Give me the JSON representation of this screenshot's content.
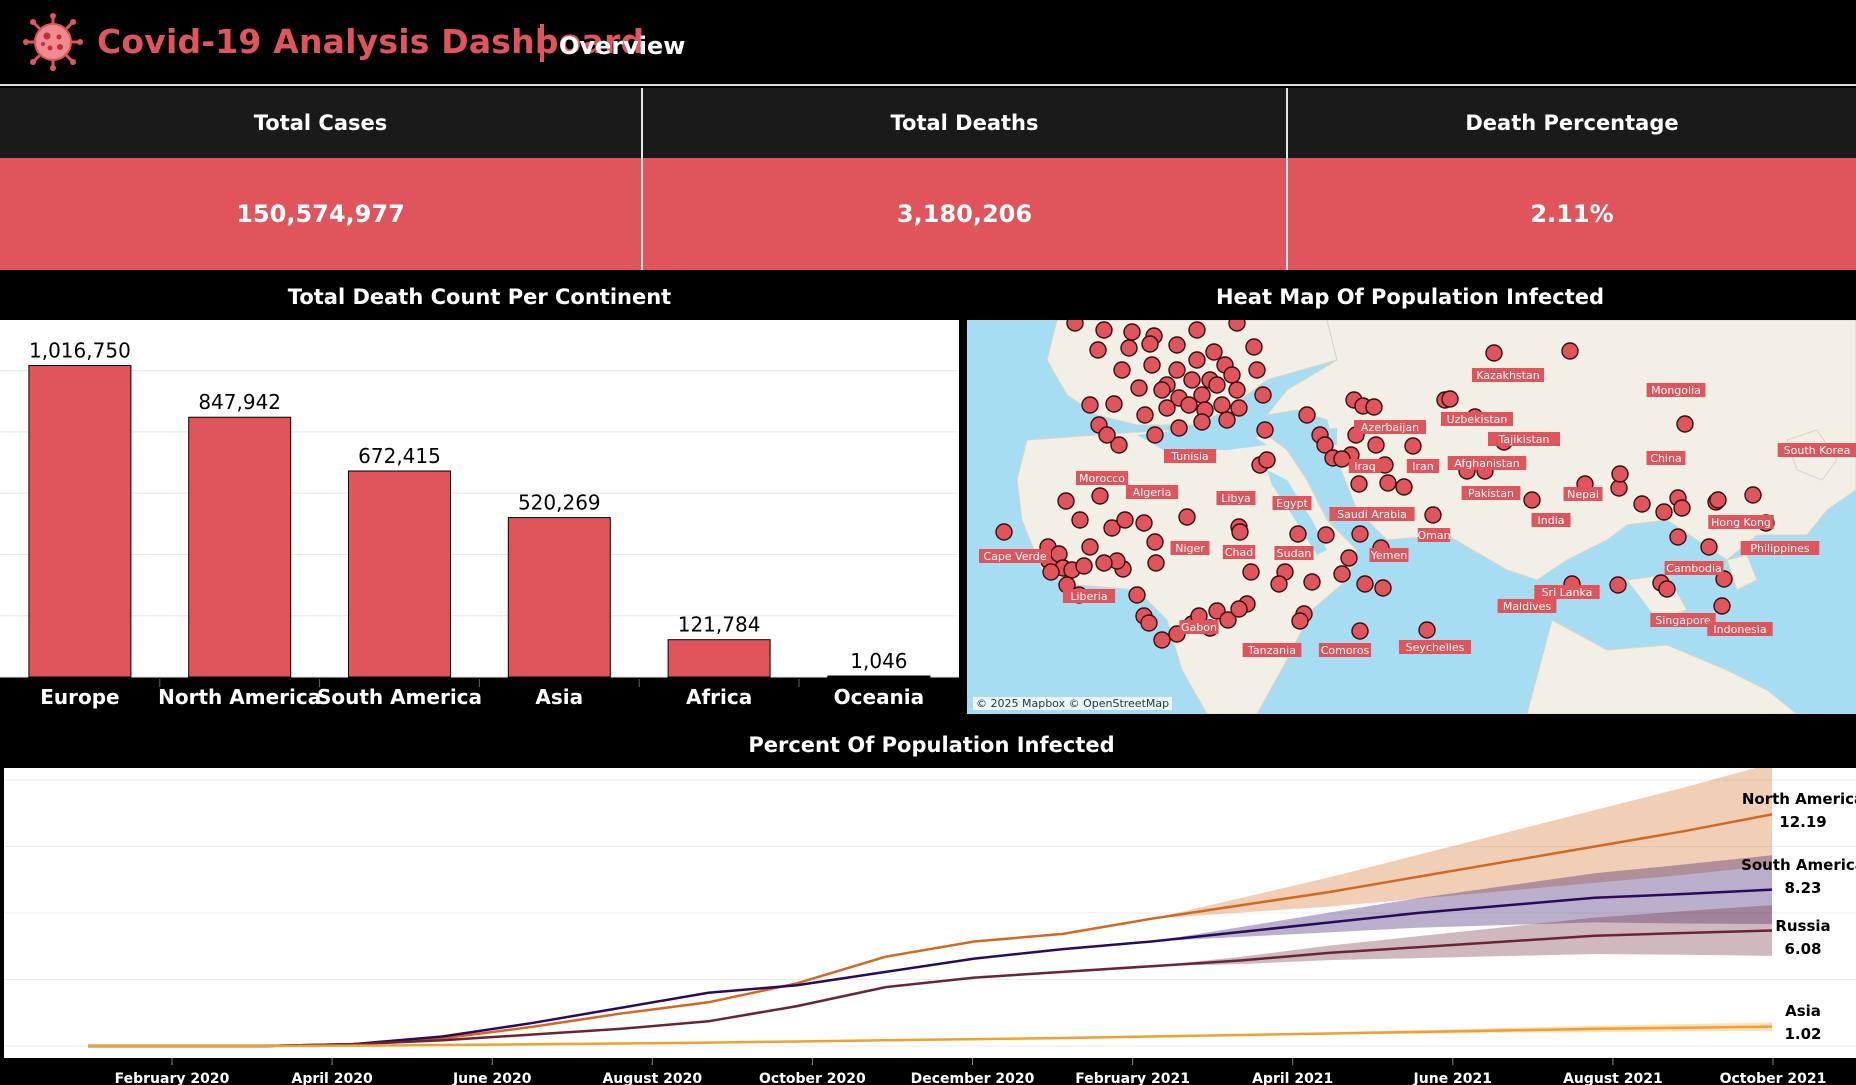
{
  "header": {
    "title": "Covid-19 Analysis Dashboard",
    "subtitle": "Overview",
    "logo_icon": "virus-icon",
    "accent_color": "#e0555b"
  },
  "kpis": [
    {
      "label": "Total Cases",
      "value": "150,574,977"
    },
    {
      "label": "Total Deaths",
      "value": "3,180,206"
    },
    {
      "label": "Death Percentage",
      "value": "2.11%"
    }
  ],
  "bar_panel": {
    "title": "Total Death Count Per Continent"
  },
  "map_panel": {
    "title": "Heat Map Of Population Infected",
    "attribution": "© 2025 Mapbox © OpenStreetMap",
    "labels": [
      "Kazakhstan",
      "Mongolia",
      "Azerbaijan",
      "Uzbekistan",
      "Tajikistan",
      "South Korea",
      "Tunisia",
      "Iraq",
      "Iran",
      "Afghanistan",
      "China",
      "Morocco",
      "Algeria",
      "Libya",
      "Egypt",
      "Saudi Arabia",
      "Pakistan",
      "Nepal",
      "India",
      "Oman",
      "Hong Kong",
      "Philippines",
      "Cape Verde",
      "Niger",
      "Chad",
      "Sudan",
      "Yemen",
      "Cambodia",
      "Liberia",
      "Maldives",
      "Sri Lanka",
      "Singapore",
      "Gabon",
      "Indonesia",
      "Tanzania",
      "Comoros",
      "Seychelles"
    ]
  },
  "line_panel": {
    "title": "Percent Of Population Infected"
  },
  "chart_data": [
    {
      "type": "bar",
      "title": "Total Death Count Per Continent",
      "categories": [
        "Europe",
        "North America",
        "South America",
        "Asia",
        "Africa",
        "Oceania"
      ],
      "values": [
        1016750,
        847942,
        672415,
        520269,
        121784,
        1046
      ],
      "data_labels": [
        "1,016,750",
        "847,942",
        "672,415",
        "520,269",
        "121,784",
        "1,046"
      ],
      "bar_color": "#e0555b",
      "grid": true
    },
    {
      "type": "line",
      "title": "Percent Of Population Infected",
      "x_ticks": [
        "February 2020",
        "April 2020",
        "June 2020",
        "August 2020",
        "October 2020",
        "December 2020",
        "February 2021",
        "April 2021",
        "June 2021",
        "August 2021",
        "October 2021"
      ],
      "series": [
        {
          "name": "North America",
          "end_label": "12.19",
          "color": "#d2691e",
          "values": [
            0.0,
            0.0,
            0.0,
            0.1,
            0.4,
            1.0,
            1.7,
            2.3,
            3.3,
            4.7,
            5.5,
            5.9,
            6.7,
            7.4,
            8.1,
            8.9,
            9.7,
            10.5,
            11.3,
            12.19
          ]
        },
        {
          "name": "South America",
          "end_label": "8.23",
          "color": "#2a0a5e",
          "values": [
            0.0,
            0.0,
            0.0,
            0.1,
            0.5,
            1.2,
            2.0,
            2.8,
            3.2,
            3.9,
            4.6,
            5.1,
            5.5,
            6.0,
            6.5,
            7.0,
            7.4,
            7.8,
            8.0,
            8.23
          ]
        },
        {
          "name": "Russia",
          "end_label": "6.08",
          "color": "#6b2434",
          "values": [
            0.0,
            0.0,
            0.0,
            0.1,
            0.3,
            0.6,
            0.9,
            1.3,
            2.1,
            3.1,
            3.6,
            3.9,
            4.2,
            4.5,
            4.9,
            5.2,
            5.5,
            5.8,
            5.95,
            6.08
          ]
        },
        {
          "name": "Asia",
          "end_label": "1.02",
          "color": "#f0a030",
          "values": [
            0.0,
            0.0,
            0.0,
            0.02,
            0.05,
            0.09,
            0.13,
            0.18,
            0.24,
            0.3,
            0.36,
            0.42,
            0.5,
            0.58,
            0.66,
            0.74,
            0.82,
            0.9,
            0.96,
            1.02
          ]
        }
      ],
      "ylim": [
        0,
        14
      ],
      "grid": true,
      "forecast_bands": true
    }
  ]
}
